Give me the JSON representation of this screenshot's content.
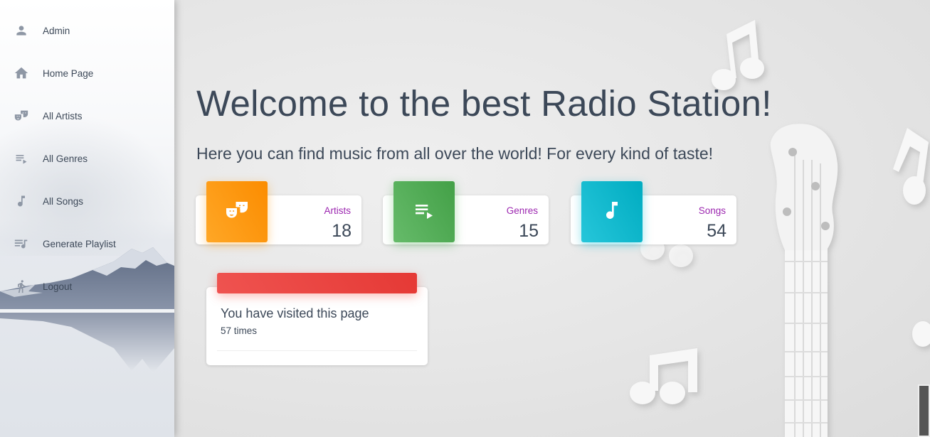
{
  "sidebar": {
    "items": [
      {
        "label": "Admin",
        "icon": "person-icon"
      },
      {
        "label": "Home Page",
        "icon": "home-icon"
      },
      {
        "label": "All Artists",
        "icon": "theater-masks-icon"
      },
      {
        "label": "All Genres",
        "icon": "playlist-play-icon"
      },
      {
        "label": "All Songs",
        "icon": "music-note-icon"
      },
      {
        "label": "Generate Playlist",
        "icon": "queue-music-icon"
      },
      {
        "label": "Logout",
        "icon": "logout-icon"
      }
    ]
  },
  "main": {
    "title": "Welcome to the best Radio Station!",
    "subtitle": "Here you can find music from all over the world! For every kind of taste!",
    "stats": [
      {
        "category": "Artists",
        "value": "18",
        "color": "#fb8c00",
        "icon": "theater-masks-icon"
      },
      {
        "category": "Genres",
        "value": "15",
        "color": "#43a047",
        "icon": "playlist-play-icon"
      },
      {
        "category": "Songs",
        "value": "54",
        "color": "#00acc1",
        "icon": "music-note-icon"
      }
    ],
    "visits": {
      "title": "You have visited this page",
      "count_text": "57 times",
      "color": "#e53935"
    }
  },
  "colors": {
    "text": "#3c4858",
    "category": "#9c27b0"
  }
}
